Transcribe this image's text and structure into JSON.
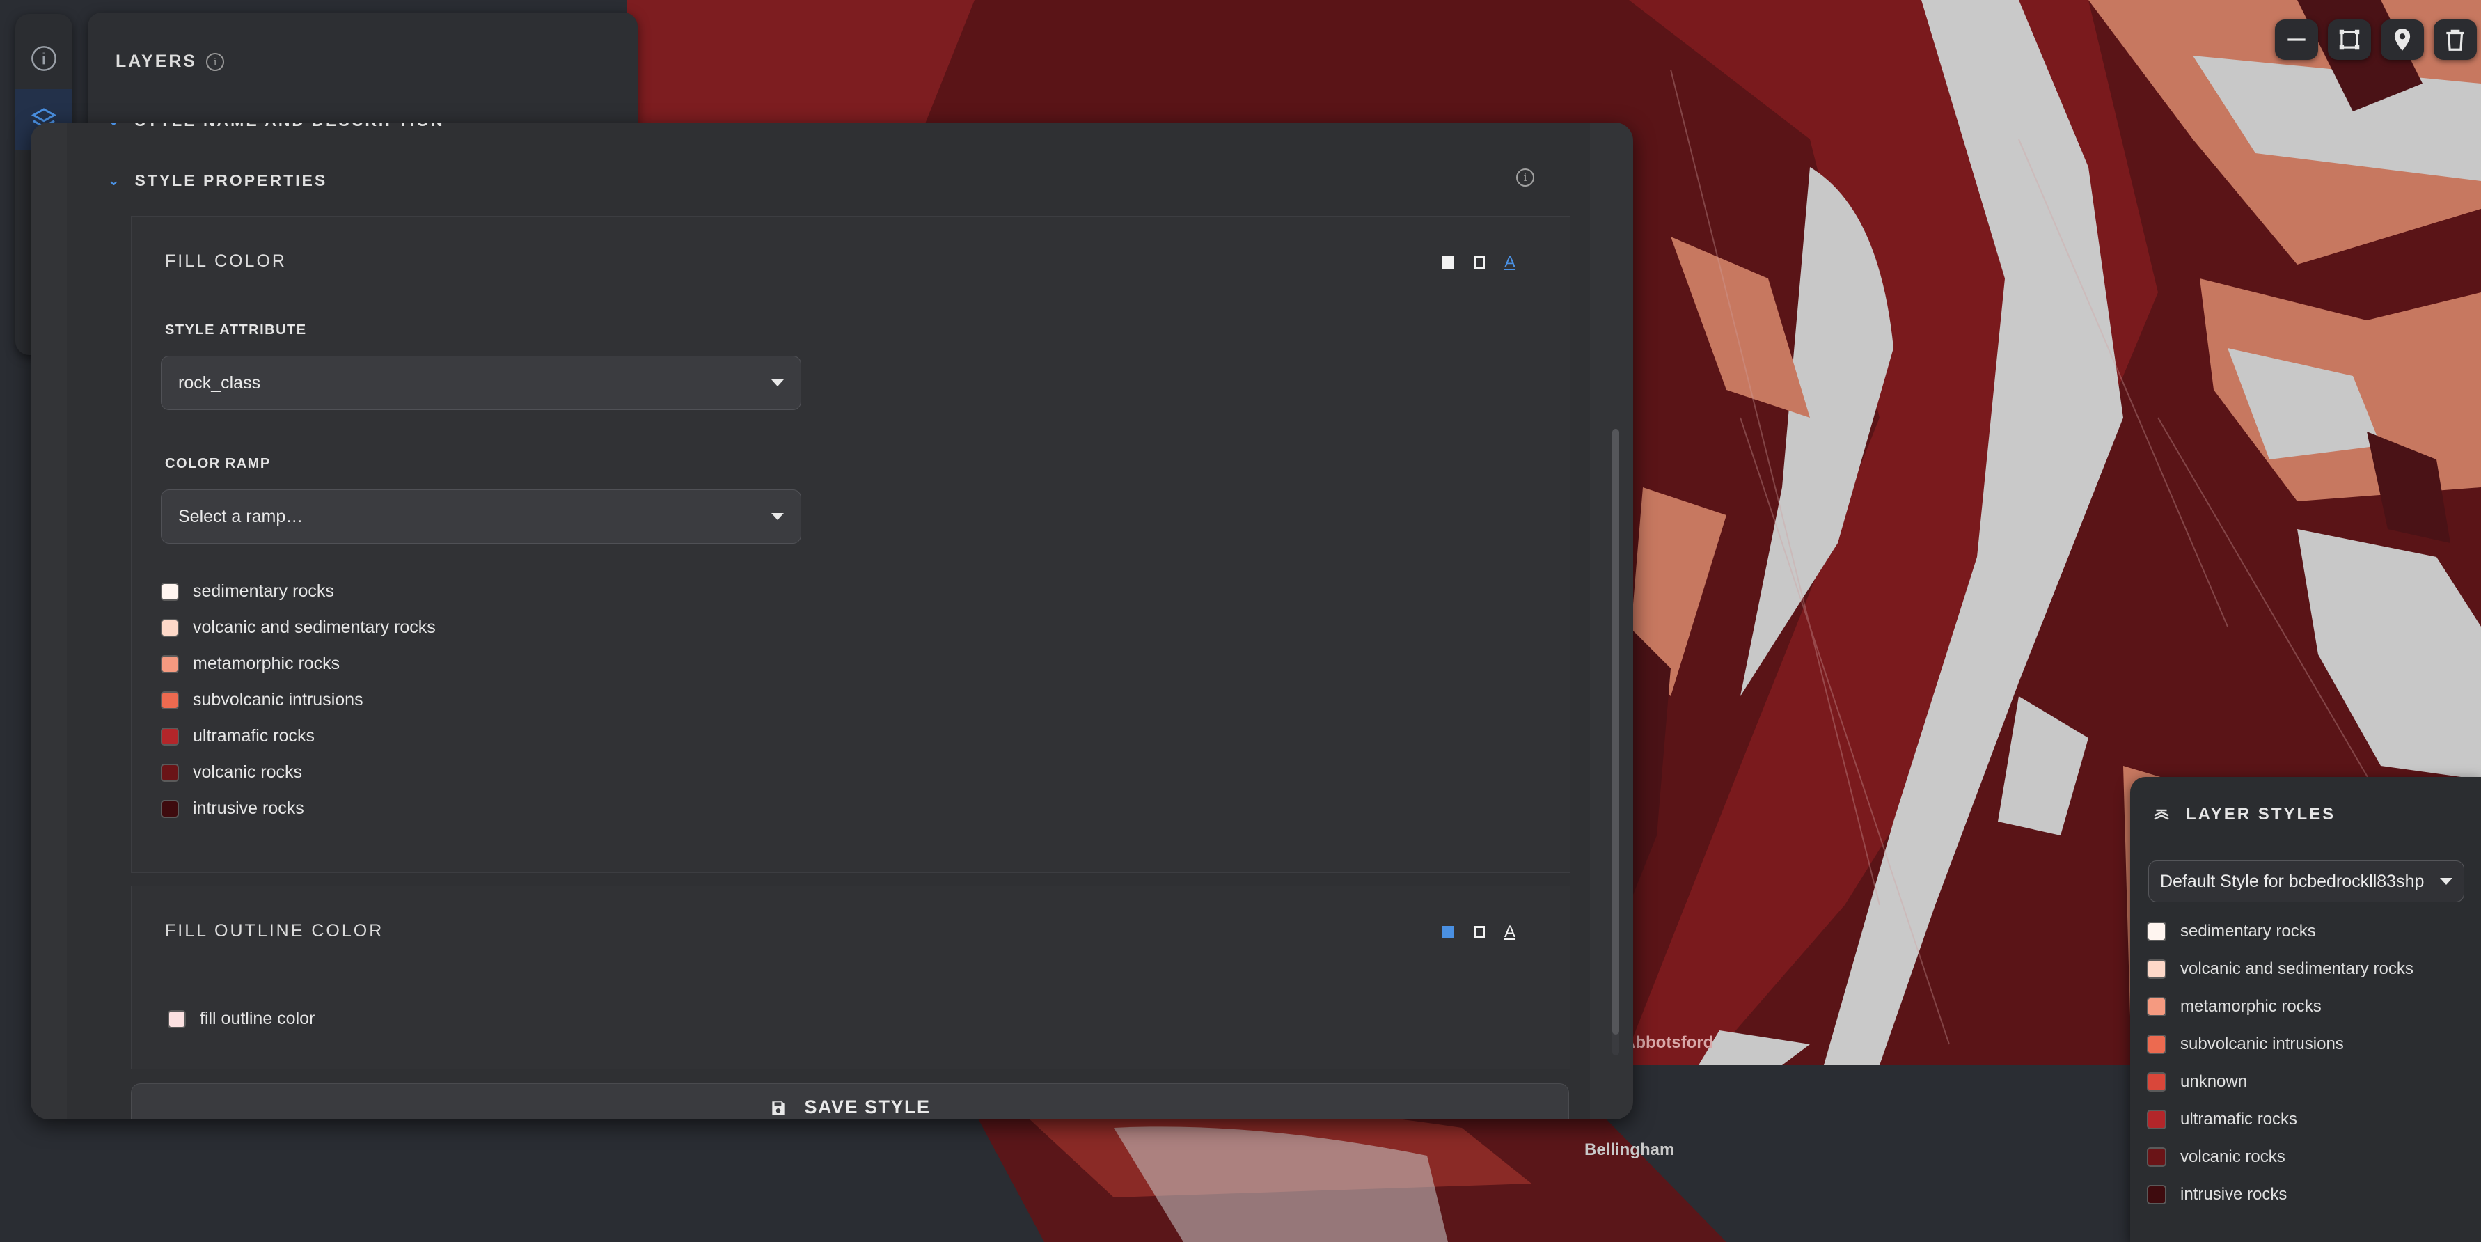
{
  "map": {
    "labels": {
      "abbotsford": "Abbotsford",
      "bellingham": "Bellingham"
    },
    "colors": {
      "rock_dark": "#4a1216",
      "rock_mid": "#7d1d20",
      "rock_salmon": "#c77860",
      "rock_grey": "#c8c8c8",
      "water": "#2a2d33"
    }
  },
  "map_tools": [
    {
      "name": "minimize-icon"
    },
    {
      "name": "draw-polygon-icon"
    },
    {
      "name": "map-pin-icon"
    },
    {
      "name": "trash-icon"
    }
  ],
  "sidebar": {
    "items": [
      {
        "icon": "info-icon"
      },
      {
        "icon": "layers-icon",
        "active": true
      }
    ]
  },
  "layers_panel": {
    "title": "LAYERS"
  },
  "editor": {
    "collapsed_section": "STYLE NAME AND DESCRIPTION",
    "section_title": "STYLE PROPERTIES",
    "fill_color": {
      "title": "FILL COLOR",
      "style_attribute_label": "STYLE ATTRIBUTE",
      "style_attribute_value": "rock_class",
      "color_ramp_label": "COLOR RAMP",
      "color_ramp_placeholder": "Select a ramp…",
      "legend": [
        {
          "label": "sedimentary rocks",
          "color": "#fff5f0"
        },
        {
          "label": "volcanic and sedimentary rocks",
          "color": "#fdd8c8"
        },
        {
          "label": "metamorphic rocks",
          "color": "#f59a80"
        },
        {
          "label": "subvolcanic intrusions",
          "color": "#ec6a50"
        },
        {
          "label": "ultramafic rocks",
          "color": "#b3262a"
        },
        {
          "label": "volcanic rocks",
          "color": "#6a1417"
        },
        {
          "label": "intrusive rocks",
          "color": "#3e0b0e"
        }
      ]
    },
    "fill_outline_color": {
      "title": "FILL OUTLINE COLOR",
      "item_label": "fill outline color",
      "item_color": "#fbe1e1"
    },
    "save_label": "SAVE STYLE"
  },
  "layer_styles": {
    "title": "LAYER STYLES",
    "selected_style": "Default Style for bcbedrockll83shp",
    "legend": [
      {
        "label": "sedimentary rocks",
        "color": "#fff5f0"
      },
      {
        "label": "volcanic and sedimentary rocks",
        "color": "#fdd8c8"
      },
      {
        "label": "metamorphic rocks",
        "color": "#f59a80"
      },
      {
        "label": "subvolcanic intrusions",
        "color": "#ec6a50"
      },
      {
        "label": "unknown",
        "color": "#d9473a"
      },
      {
        "label": "ultramafic rocks",
        "color": "#b3262a"
      },
      {
        "label": "volcanic rocks",
        "color": "#6a1417"
      },
      {
        "label": "intrusive rocks",
        "color": "#3e0b0e"
      }
    ]
  }
}
